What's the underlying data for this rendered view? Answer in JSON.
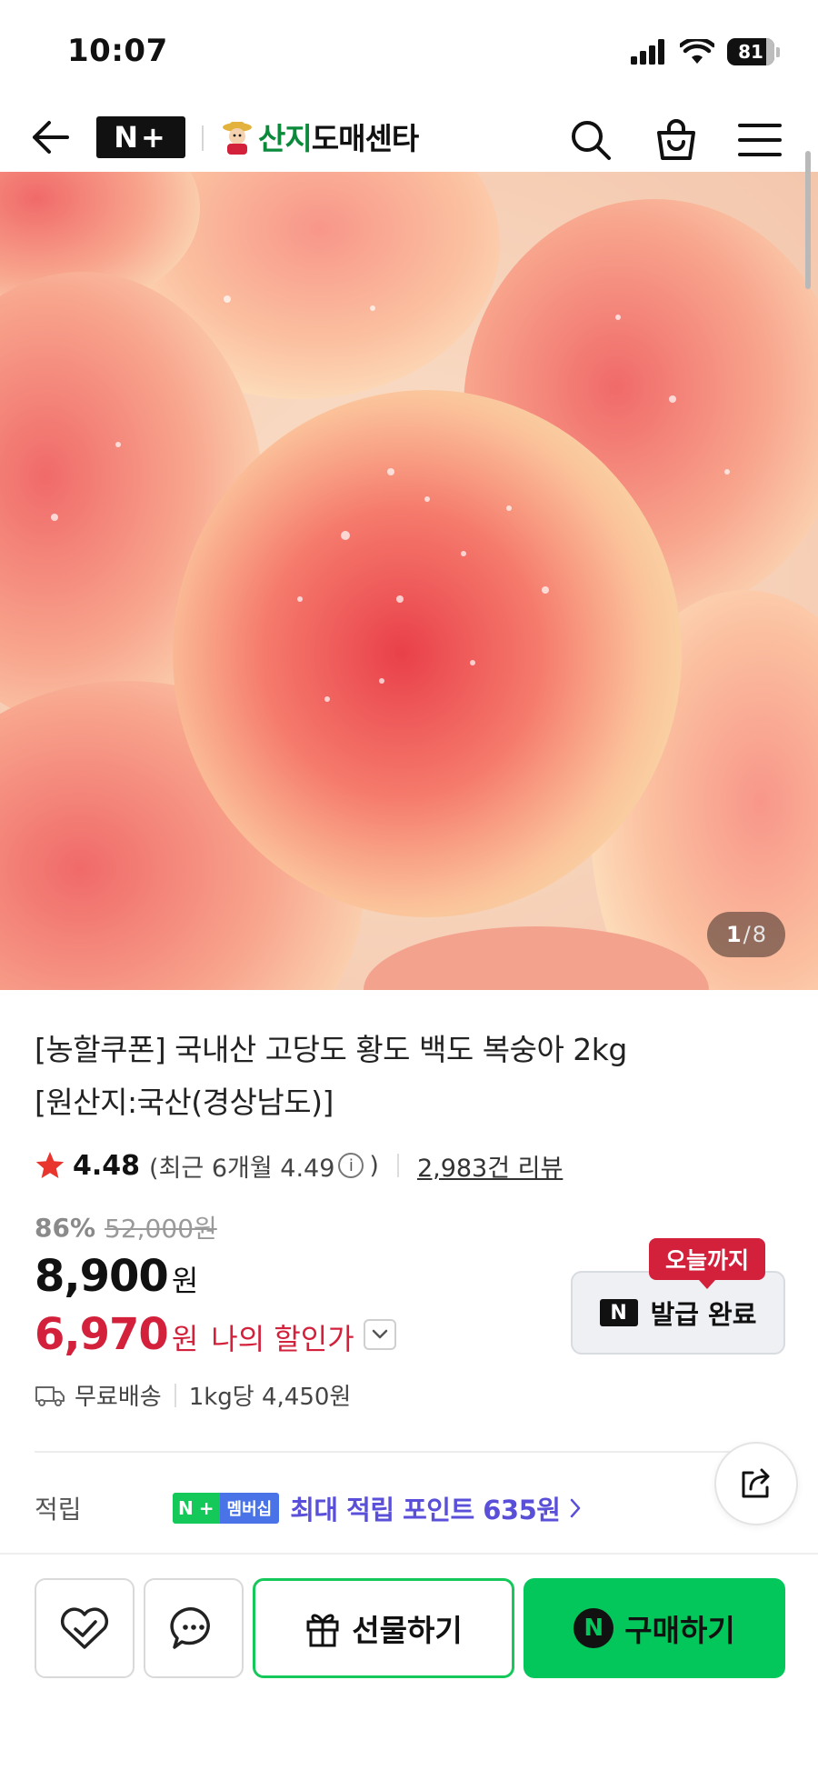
{
  "status_bar": {
    "time": "10:07",
    "battery": "81"
  },
  "header": {
    "naver_plus_logo": "N+",
    "store_name_green": "산지",
    "store_name_rest": "도매센타",
    "icons": [
      "back-arrow-icon",
      "search-icon",
      "shopping-bag-icon",
      "menu-icon"
    ]
  },
  "gallery": {
    "current": "1",
    "separator": "/",
    "total": "8"
  },
  "product": {
    "title_line1": "[농할쿠폰] 국내산 고당도 황도 백도 복숭아 2kg",
    "title_line2": "[원산지:국산(경상남도)]",
    "rating": "4.48",
    "recent_rating_prefix": "(최근 6개월 4.49",
    "recent_rating_suffix": ")",
    "info_glyph": "i",
    "review_count": "2,983건 리뷰",
    "discount_rate": "86%",
    "original_price": "52,000원",
    "price": "8,900",
    "price_unit": "원",
    "my_price": "6,970",
    "my_price_unit": "원",
    "my_price_label": "나의 할인가"
  },
  "coupon": {
    "badge": "오늘까지",
    "n_label": "N",
    "button_label": "발급 완료"
  },
  "delivery": {
    "shipping": "무료배송",
    "unit_price": "1kg당 4,450원"
  },
  "points": {
    "label": "적립",
    "badge_n": "N",
    "badge_plus": "+",
    "badge_membership": "멤버십",
    "text": "최대 적립 포인트 635원"
  },
  "bottom_bar": {
    "gift_label": "선물하기",
    "buy_n": "N",
    "buy_label": "구매하기"
  },
  "colors": {
    "naver_green": "#03c75a",
    "discount_red": "#d3203b",
    "points_purple": "#5a4fd8",
    "membership_blue": "#4a73e8"
  }
}
